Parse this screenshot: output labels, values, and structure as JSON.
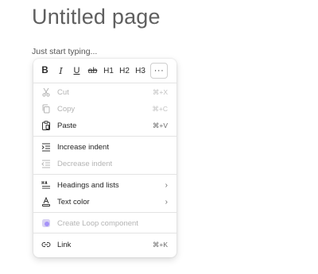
{
  "page": {
    "title": "Untitled page",
    "placeholder": "Just start typing..."
  },
  "format_toolbar": {
    "bold": "B",
    "italic": "I",
    "underline": "U",
    "strikethrough": "ab",
    "h1": "H1",
    "h2": "H2",
    "h3": "H3",
    "more": "···"
  },
  "context_menu": {
    "cut": {
      "label": "Cut",
      "shortcut": "⌘+X",
      "icon": "scissors-icon",
      "enabled": false
    },
    "copy": {
      "label": "Copy",
      "shortcut": "⌘+C",
      "icon": "copy-icon",
      "enabled": false
    },
    "paste": {
      "label": "Paste",
      "shortcut": "⌘+V",
      "icon": "clipboard-icon",
      "enabled": true
    },
    "increase_indent": {
      "label": "Increase indent",
      "icon": "indent-increase-icon",
      "enabled": true
    },
    "decrease_indent": {
      "label": "Decrease indent",
      "icon": "indent-decrease-icon",
      "enabled": false
    },
    "headings_lists": {
      "label": "Headings and lists",
      "chevron": "›",
      "icon": "headings-icon",
      "enabled": true
    },
    "text_color": {
      "label": "Text color",
      "chevron": "›",
      "icon": "text-color-icon",
      "enabled": true
    },
    "loop_component": {
      "label": "Create Loop component",
      "icon": "loop-icon",
      "enabled": false
    },
    "link": {
      "label": "Link",
      "shortcut": "⌘+K",
      "icon": "link-icon",
      "enabled": true
    }
  },
  "colors": {
    "title": "#5f5f5f",
    "disabled_text": "#b4b4b4",
    "loop_accent": "#7b5cff"
  }
}
